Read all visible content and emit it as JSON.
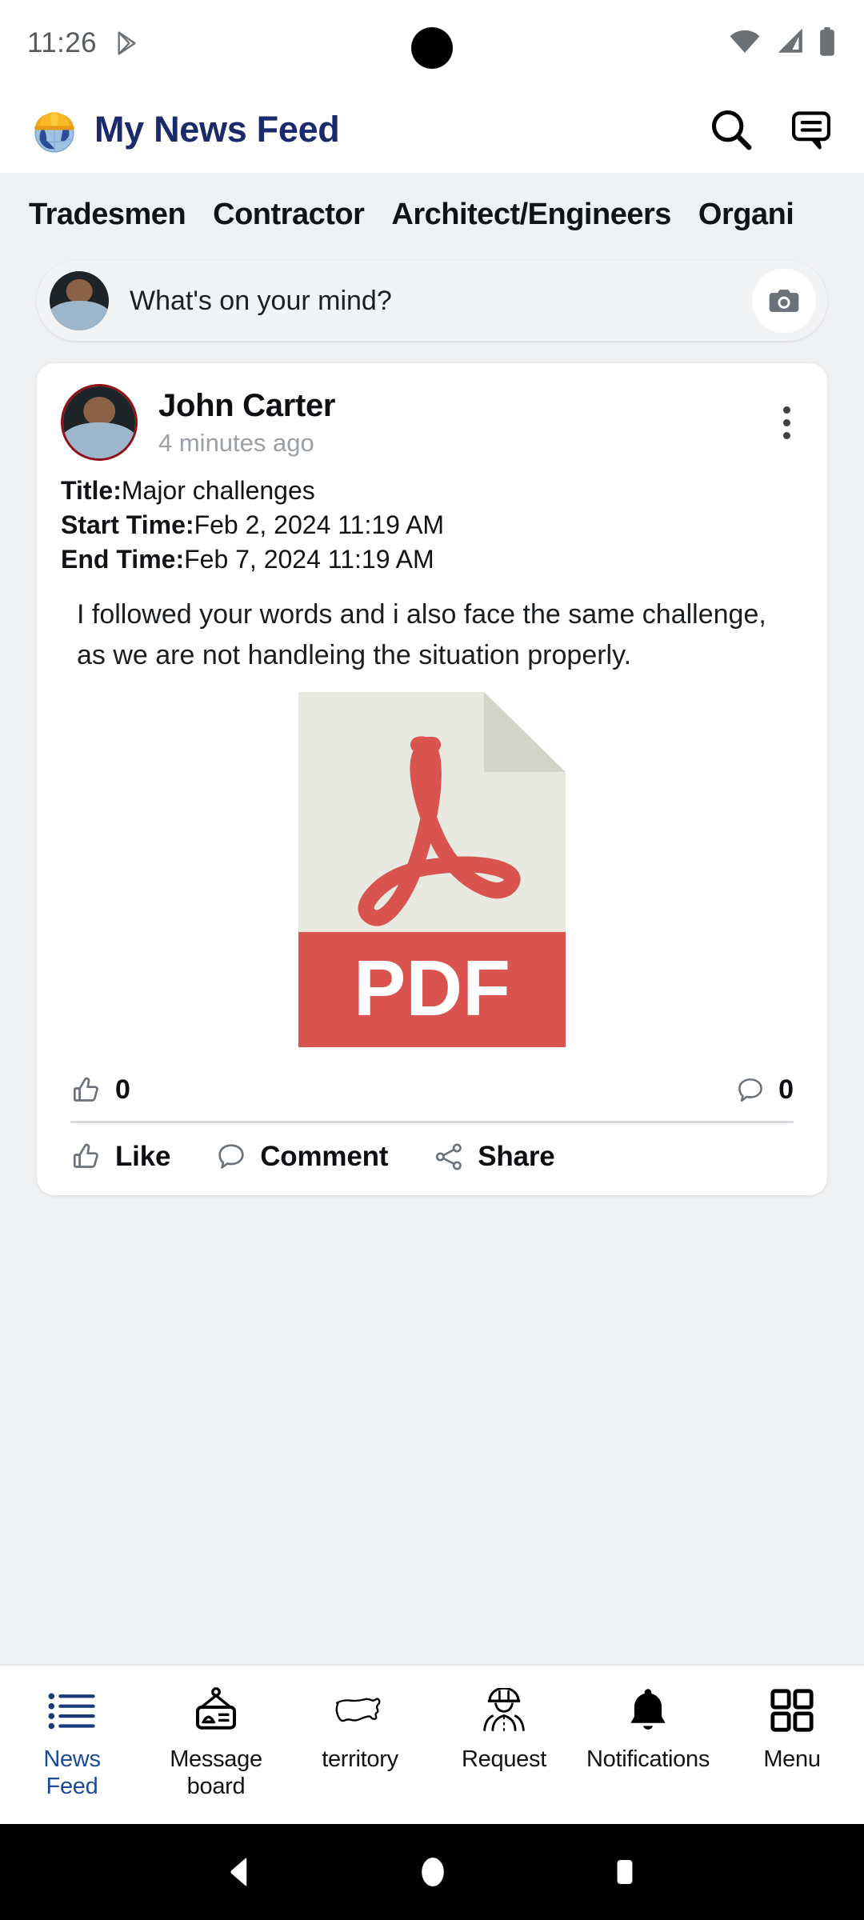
{
  "statusbar": {
    "clock": "11:26",
    "icons": [
      "play-store-icon",
      "wifi-icon",
      "cellular-signal-icon",
      "battery-icon"
    ]
  },
  "header": {
    "title": "My News Feed",
    "logo_name": "globe-hardhat-logo",
    "title_color": "#1b2a6b",
    "actions": [
      {
        "name": "search-icon",
        "label": "Search"
      },
      {
        "name": "messages-icon",
        "label": "Messages"
      }
    ]
  },
  "tabs": [
    {
      "label": "Tradesmen"
    },
    {
      "label": "Contractor"
    },
    {
      "label": "Architect/Engineers"
    },
    {
      "label": "Organi"
    }
  ],
  "composer": {
    "placeholder": "What's on your mind?",
    "camera_icon": "camera-icon",
    "avatar_name": "current-user-avatar"
  },
  "post": {
    "author": "John Carter",
    "timestamp": "4 minutes ago",
    "menu_icon": "more-options-icon",
    "meta": [
      {
        "label": "Title:",
        "value": "Major challenges"
      },
      {
        "label": "Start Time:",
        "value": "Feb 2, 2024 11:19 AM"
      },
      {
        "label": "End Time:",
        "value": "Feb 7, 2024 11:19 AM"
      }
    ],
    "body": "I followed your words and i also face the same challenge, as we are not handleing the situation properly.",
    "attachment": {
      "type": "pdf",
      "label": "PDF",
      "band_color": "#d9534f",
      "page_color": "#e8e9e1"
    },
    "like_count": "0",
    "comment_count": "0",
    "actions": [
      {
        "name": "like-button",
        "label": "Like",
        "icon": "thumbs-up-icon"
      },
      {
        "name": "comment-button",
        "label": "Comment",
        "icon": "comment-bubble-icon"
      },
      {
        "name": "share-button",
        "label": "Share",
        "icon": "share-nodes-icon"
      }
    ]
  },
  "bottomnav": {
    "active_color": "#1b4a9c",
    "items": [
      {
        "label": "News\nFeed",
        "icon": "list-lines-icon",
        "active": true
      },
      {
        "label": "Message\nboard",
        "icon": "message-board-sign-icon",
        "active": false
      },
      {
        "label": "territory",
        "icon": "usa-map-icon",
        "active": false
      },
      {
        "label": "Request",
        "icon": "worker-helmet-icon",
        "active": false
      },
      {
        "label": "Notifications",
        "icon": "bell-icon",
        "active": false
      },
      {
        "label": "Menu",
        "icon": "grid-squares-icon",
        "active": false
      }
    ]
  },
  "sysnav": {
    "keys": [
      {
        "name": "back-button",
        "icon": "triangle-back-icon"
      },
      {
        "name": "home-button",
        "icon": "circle-home-icon"
      },
      {
        "name": "recents-button",
        "icon": "square-recents-icon"
      }
    ]
  }
}
